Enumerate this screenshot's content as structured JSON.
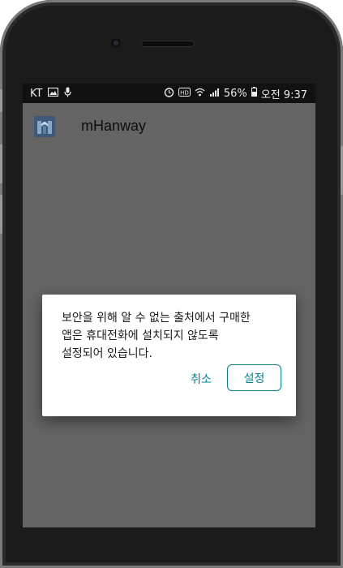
{
  "status_bar": {
    "carrier": "KT",
    "battery_percent": "56%",
    "time": "오전 9:37",
    "icons_left": [
      "image-icon",
      "mic-icon"
    ],
    "icons_right": [
      "alarm-icon",
      "hd-icon",
      "wifi-icon",
      "signal-icon",
      "battery-icon"
    ]
  },
  "app_bar": {
    "title": "mHanway",
    "logo": "app-logo-icon"
  },
  "dialog": {
    "message": "보안을 위해 알 수 없는 출처에서 구매한\n앱은 휴대전화에 설치되지 않도록\n설정되어 있습니다.",
    "cancel_label": "취소",
    "confirm_label": "설정"
  },
  "colors": {
    "accent": "#00838f",
    "scrim": "#646464",
    "status_bar": "#111111",
    "phone_body": "#1b1b1b"
  }
}
